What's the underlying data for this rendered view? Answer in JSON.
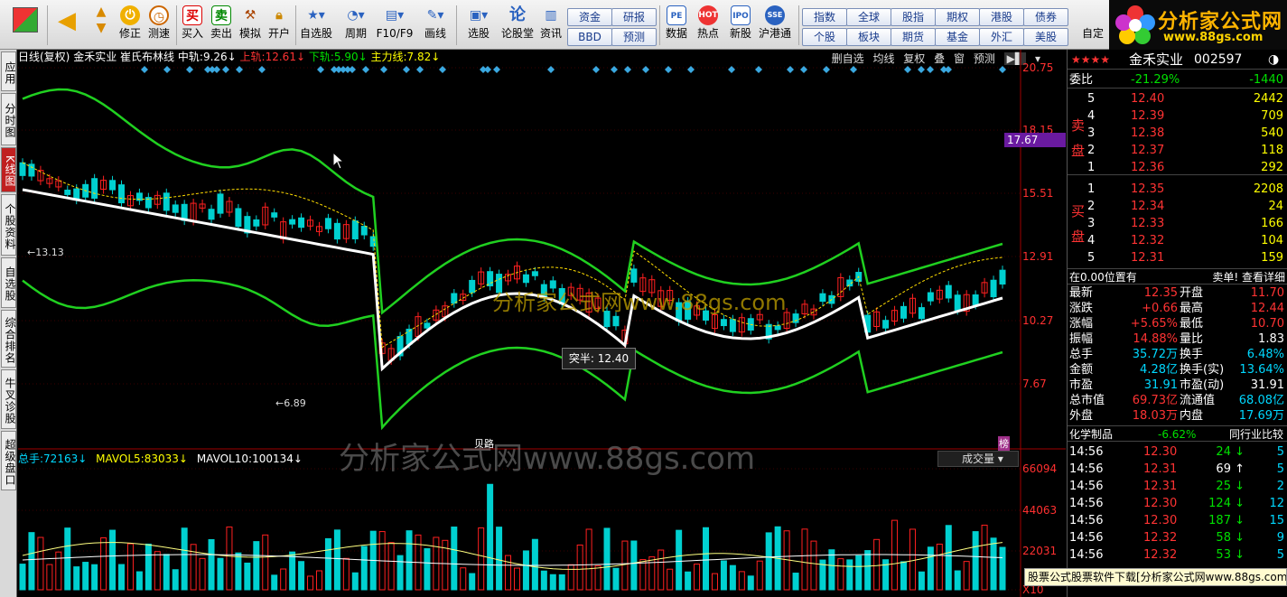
{
  "toolbar": {
    "buttons": [
      "买入",
      "卖出",
      "模拟",
      "开户"
    ],
    "nav": [
      "修正",
      "测速"
    ],
    "tools": [
      "自选股",
      "周期",
      "F10/F9",
      "画线",
      "选股",
      "论股堂",
      "资讯",
      "数据",
      "热点",
      "新股",
      "沪港通"
    ],
    "small": [
      [
        "资金",
        "BBD"
      ],
      [
        "研报",
        "预测"
      ],
      [
        "指数",
        "个股"
      ],
      [
        "全球",
        "板块"
      ],
      [
        "股指",
        "期货"
      ],
      [
        "期权",
        "基金"
      ],
      [
        "港股",
        "外汇"
      ],
      [
        "债券",
        "美股"
      ]
    ],
    "extra": "自定"
  },
  "logo": {
    "title": "分析家公式网",
    "url": "www.88gs.com"
  },
  "left_tabs": [
    "应用",
    "分时图",
    "K线图",
    "个股资料",
    "自选股",
    "综合排名",
    "牛叉诊股",
    "超级盘口"
  ],
  "chart": {
    "header": {
      "period": "日线(复权)",
      "name": "金禾实业",
      "indicator": "崔氏布林线",
      "mid_label": "中轨:",
      "mid": "9.26",
      "up_label": "上轨:",
      "up": "12.61",
      "down_label": "下轨:",
      "down": "5.90",
      "main_label": "主力线:",
      "main": "7.82"
    },
    "controls": [
      "删自选",
      "均线",
      "复权",
      "叠",
      "窗",
      "预测"
    ],
    "price_ticks": [
      "20.75",
      "18.15",
      "15.51",
      "12.91",
      "10.27",
      "7.67"
    ],
    "current_price_tag": "17.67",
    "annot_high": "13.13",
    "annot_low": "6.89",
    "tooltip": "突半: 12.40",
    "watermark": "分析家公式网www.88gs.com",
    "tag1": "贝路",
    "tag2": "榜",
    "vol_header": {
      "total_label": "总手:",
      "total": "72163",
      "ma5_label": "MAVOL5:",
      "ma5": "83033",
      "ma10_label": "MAVOL10:",
      "ma10": "100134",
      "dropdown": "成交量"
    },
    "vol_ticks": [
      "66094",
      "44063",
      "22031",
      "X10"
    ],
    "colors": {
      "upper": "#ff2020",
      "lower": "#20d020",
      "mid": "#ffffff",
      "up_candle": "#ff2020",
      "down_candle": "#00d0d0"
    }
  },
  "quote": {
    "stars": "★★★★",
    "name": "金禾实业",
    "code": "002597",
    "ratio_label": "委比",
    "ratio": "-21.29%",
    "ratio_diff": "-1440",
    "sell_label": "卖盘",
    "buy_label": "买盘",
    "sell": [
      [
        "5",
        "12.40",
        "2442"
      ],
      [
        "4",
        "12.39",
        "709"
      ],
      [
        "3",
        "12.38",
        "540"
      ],
      [
        "2",
        "12.37",
        "118"
      ],
      [
        "1",
        "12.36",
        "292"
      ]
    ],
    "buy": [
      [
        "1",
        "12.35",
        "2208"
      ],
      [
        "2",
        "12.34",
        "24"
      ],
      [
        "3",
        "12.33",
        "166"
      ],
      [
        "4",
        "12.32",
        "104"
      ],
      [
        "5",
        "12.31",
        "159"
      ]
    ],
    "pos_note": "在0.00位置有",
    "sell_note": "卖单! 查看详细",
    "stats": [
      [
        "最新",
        "12.35",
        "开盘",
        "11.70"
      ],
      [
        "涨跌",
        "+0.66",
        "最高",
        "12.44"
      ],
      [
        "涨幅",
        "+5.65%",
        "最低",
        "10.70"
      ],
      [
        "振幅",
        "14.88%",
        "量比",
        "1.83"
      ],
      [
        "总手",
        "35.72万",
        "换手",
        "6.48%"
      ],
      [
        "金额",
        "4.28亿",
        "换手(实)",
        "13.64%"
      ],
      [
        "市盈",
        "31.91",
        "市盈(动)",
        "31.91"
      ],
      [
        "总市值",
        "69.73亿",
        "流通值",
        "68.08亿"
      ],
      [
        "外盘",
        "18.03万",
        "内盘",
        "17.69万"
      ]
    ],
    "industry": "化学制品",
    "industry_pct": "-6.62%",
    "industry_cmp": "同行业比较",
    "ticks": [
      [
        "14:56",
        "12.30",
        "24",
        "↓",
        "5"
      ],
      [
        "14:56",
        "12.31",
        "69",
        "↑",
        "5"
      ],
      [
        "14:56",
        "12.31",
        "25",
        "↓",
        "2"
      ],
      [
        "14:56",
        "12.30",
        "124",
        "↓",
        "12"
      ],
      [
        "14:56",
        "12.30",
        "187",
        "↓",
        "15"
      ],
      [
        "14:56",
        "12.32",
        "58",
        "↓",
        "9"
      ],
      [
        "14:56",
        "12.32",
        "53",
        "↓",
        "5"
      ]
    ]
  },
  "banner": "股票公式股票软件下载[分析家公式网www.88gs.com"
}
